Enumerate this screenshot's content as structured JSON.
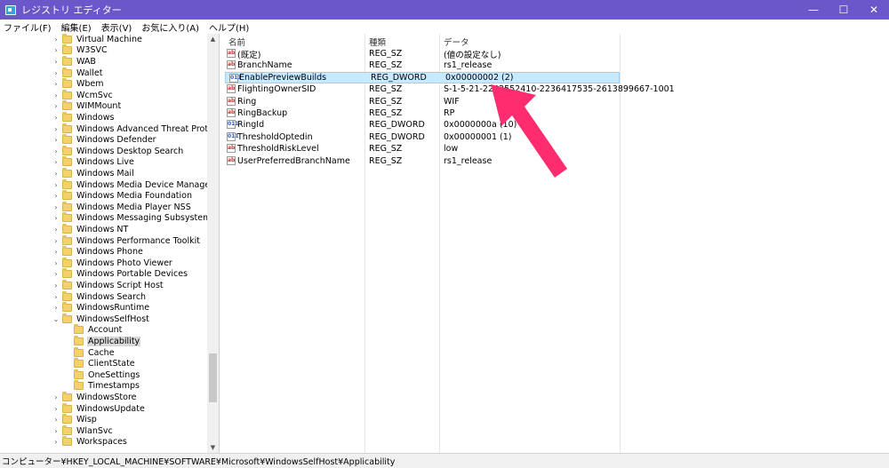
{
  "window": {
    "title": "レジストリ エディター",
    "minimize": "—",
    "maximize": "☐",
    "close": "✕"
  },
  "menu": [
    "ファイル(F)",
    "編集(E)",
    "表示(V)",
    "お気に入り(A)",
    "ヘルプ(H)"
  ],
  "tree": [
    {
      "label": "Virtual Machine",
      "level": 0,
      "expander": "›"
    },
    {
      "label": "W3SVC",
      "level": 0,
      "expander": "›"
    },
    {
      "label": "WAB",
      "level": 0,
      "expander": "›"
    },
    {
      "label": "Wallet",
      "level": 0,
      "expander": "›"
    },
    {
      "label": "Wbem",
      "level": 0,
      "expander": "›"
    },
    {
      "label": "WcmSvc",
      "level": 0,
      "expander": "›"
    },
    {
      "label": "WIMMount",
      "level": 0,
      "expander": "›"
    },
    {
      "label": "Windows",
      "level": 0,
      "expander": "›"
    },
    {
      "label": "Windows Advanced Threat Protection",
      "level": 0,
      "expander": "›"
    },
    {
      "label": "Windows Defender",
      "level": 0,
      "expander": "›"
    },
    {
      "label": "Windows Desktop Search",
      "level": 0,
      "expander": "›"
    },
    {
      "label": "Windows Live",
      "level": 0,
      "expander": "›"
    },
    {
      "label": "Windows Mail",
      "level": 0,
      "expander": "›"
    },
    {
      "label": "Windows Media Device Manager",
      "level": 0,
      "expander": "›"
    },
    {
      "label": "Windows Media Foundation",
      "level": 0,
      "expander": "›"
    },
    {
      "label": "Windows Media Player NSS",
      "level": 0,
      "expander": "›"
    },
    {
      "label": "Windows Messaging Subsystem",
      "level": 0,
      "expander": "›"
    },
    {
      "label": "Windows NT",
      "level": 0,
      "expander": "›"
    },
    {
      "label": "Windows Performance Toolkit",
      "level": 0,
      "expander": "›"
    },
    {
      "label": "Windows Phone",
      "level": 0,
      "expander": "›"
    },
    {
      "label": "Windows Photo Viewer",
      "level": 0,
      "expander": "›"
    },
    {
      "label": "Windows Portable Devices",
      "level": 0,
      "expander": "›"
    },
    {
      "label": "Windows Script Host",
      "level": 0,
      "expander": "›"
    },
    {
      "label": "Windows Search",
      "level": 0,
      "expander": "›"
    },
    {
      "label": "WindowsRuntime",
      "level": 0,
      "expander": "›"
    },
    {
      "label": "WindowsSelfHost",
      "level": 0,
      "expander": "⌄"
    },
    {
      "label": "Account",
      "level": 1,
      "expander": ""
    },
    {
      "label": "Applicability",
      "level": 1,
      "expander": "",
      "selected": true
    },
    {
      "label": "Cache",
      "level": 1,
      "expander": ""
    },
    {
      "label": "ClientState",
      "level": 1,
      "expander": ""
    },
    {
      "label": "OneSettings",
      "level": 1,
      "expander": ""
    },
    {
      "label": "Timestamps",
      "level": 1,
      "expander": ""
    },
    {
      "label": "WindowsStore",
      "level": 0,
      "expander": "›"
    },
    {
      "label": "WindowsUpdate",
      "level": 0,
      "expander": "›"
    },
    {
      "label": "Wisp",
      "level": 0,
      "expander": "›"
    },
    {
      "label": "WlanSvc",
      "level": 0,
      "expander": "›"
    },
    {
      "label": "Workspaces",
      "level": 0,
      "expander": "›"
    }
  ],
  "list": {
    "columns": [
      "名前",
      "種類",
      "データ"
    ],
    "rows": [
      {
        "name": "(既定)",
        "type": "REG_SZ",
        "data": "(値の設定なし)",
        "icon": "ab"
      },
      {
        "name": "BranchName",
        "type": "REG_SZ",
        "data": "rs1_release",
        "icon": "ab"
      },
      {
        "name": "EnablePreviewBuilds",
        "type": "REG_DWORD",
        "data": "0x00000002 (2)",
        "icon": "011",
        "selected": true
      },
      {
        "name": "FlightingOwnerSID",
        "type": "REG_SZ",
        "data": "S-1-5-21-2243552410-2236417535-2613899667-1001",
        "icon": "ab"
      },
      {
        "name": "Ring",
        "type": "REG_SZ",
        "data": "WIF",
        "icon": "ab"
      },
      {
        "name": "RingBackup",
        "type": "REG_SZ",
        "data": "RP",
        "icon": "ab"
      },
      {
        "name": "RingId",
        "type": "REG_DWORD",
        "data": "0x0000000a (10)",
        "icon": "011"
      },
      {
        "name": "ThresholdOptedin",
        "type": "REG_DWORD",
        "data": "0x00000001 (1)",
        "icon": "011"
      },
      {
        "name": "ThresholdRiskLevel",
        "type": "REG_SZ",
        "data": "low",
        "icon": "ab"
      },
      {
        "name": "UserPreferredBranchName",
        "type": "REG_SZ",
        "data": "rs1_release",
        "icon": "ab"
      }
    ]
  },
  "status": "コンピューター¥HKEY_LOCAL_MACHINE¥SOFTWARE¥Microsoft¥WindowsSelfHost¥Applicability",
  "colors": {
    "titlebar": "#6b57c9",
    "selection": "#cce8ff",
    "arrow": "#ff2d6f"
  },
  "icons": {
    "scroll_up": "▲",
    "scroll_down": "▼"
  }
}
